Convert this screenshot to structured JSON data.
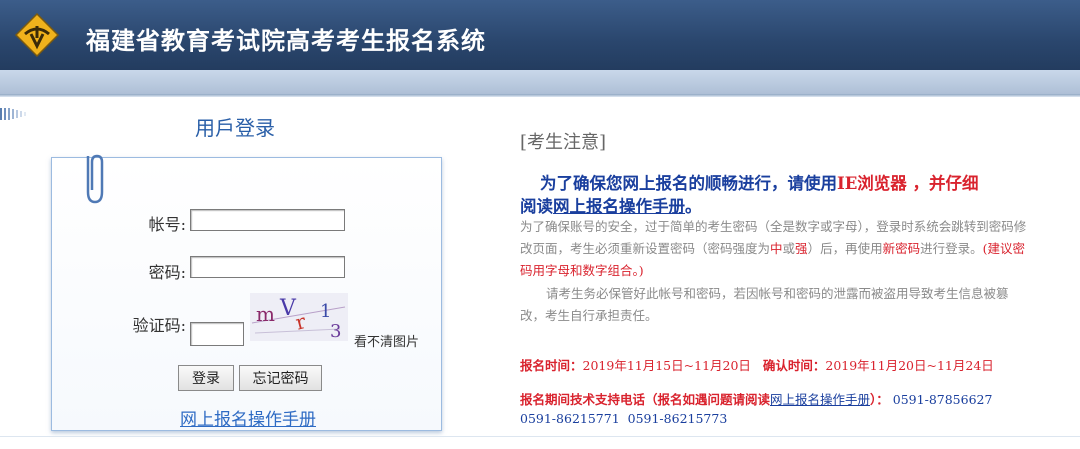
{
  "header": {
    "title": "福建省教育考试院高考考生报名系统",
    "bg_color": "#2a466d",
    "logo_icon": "exam-logo-icon"
  },
  "login": {
    "title": "用戶登录",
    "account_label": "帐号:",
    "account_value": "",
    "password_label": "密码:",
    "password_value": "",
    "captcha_label": "验证码:",
    "captcha_value": "",
    "captcha_text": "mV 1 r3",
    "captcha_refresh": "看不清图片",
    "login_button": "登录",
    "forgot_button": "忘记密码",
    "manual_link": "网上报名操作手册"
  },
  "notice": {
    "title": "[考生注意]",
    "lead_part1": "为了确保您网上报名的顺畅进行，请使用",
    "lead_red": "IE浏览器 ，并仔细",
    "lead_part2": "阅读",
    "lead_link": "网上报名操作手册",
    "lead_end": "。",
    "p1_a": "为了确保账号的安全，过于简单的考生密码（全是数字或字母），登录时系统会跳转到密码修改页面，考生必须重新设置密码（密码强度为",
    "p1_mid_red": "中",
    "p1_b": "或",
    "p1_strong_red": "强",
    "p1_c": "）后，再使用",
    "p1_new_red": "新密码",
    "p1_d": "进行登录。",
    "p1_tip": "(建议密码用字母和数字组合。)",
    "p2": "请考生务必保管好此帐号和密码，若因帐号和密码的泄露而被盗用导致考生信息被篡改，考生自行承担责任。",
    "reg_time_label": "报名时间：",
    "reg_time_value": "2019年11月15日~11月20日",
    "confirm_time_label": "确认时间：",
    "confirm_time_value": "2019年11月20日~11月24日",
    "support_label": "报名期间技术支持电话（报名如遇问题请阅读",
    "support_link": "网上报名操作手册",
    "support_end": "）：",
    "phone1": "0591-87856627",
    "phone2": "0591-86215771",
    "phone3": "0591-86215773"
  },
  "colors": {
    "accent_blue": "#1a3f9e",
    "warning_red": "#d9232e",
    "link_blue": "#2e6bc4"
  }
}
